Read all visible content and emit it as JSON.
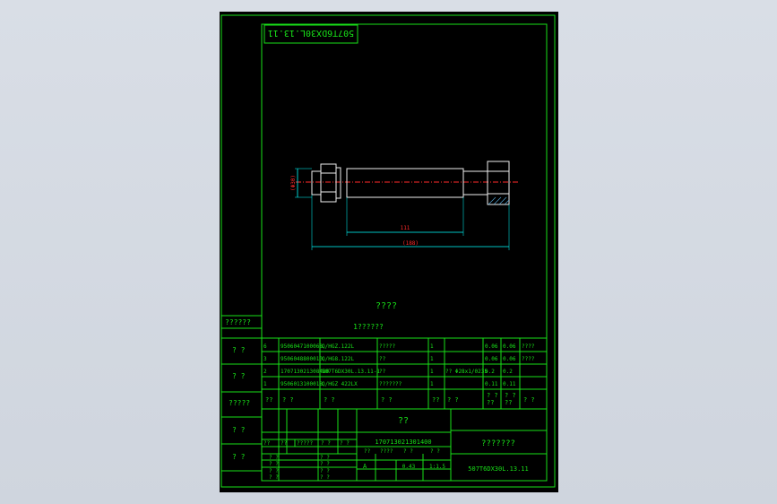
{
  "drawing": {
    "title_block_code_rotated": "507T6DX30L.13.11",
    "dimension_vertical": "(Φ30)",
    "dimension_inner_length": "111",
    "dimension_total_length": "(188)",
    "center_note_1": "????",
    "center_note_2": "1??????"
  },
  "left_strip": {
    "labels": [
      "??????",
      "? ?",
      "? ?",
      "?????",
      "? ?",
      "? ?"
    ]
  },
  "bom": {
    "rows": [
      {
        "no": "6",
        "code": "9506047100068",
        "std": "Q/HGZ.122L",
        "name": "?????",
        "qty": "1",
        "mat": "",
        "w1": "0.06",
        "w2": "0.06",
        "note": "????"
      },
      {
        "no": "3",
        "code": "9506048800010",
        "std": "Q/HG8.122L",
        "name": "??",
        "qty": "1",
        "mat": "",
        "w1": "0.06",
        "w2": "0.06",
        "note": "????"
      },
      {
        "no": "2",
        "code": "170713021308480",
        "std": "507T6DX30L.13.11-1",
        "name": "??",
        "qty": "1",
        "mat": "?? Φ28x1/0235",
        "w1": "0.2",
        "w2": "0.2",
        "note": ""
      },
      {
        "no": "1",
        "code": "9506013100018",
        "std": "Q/HGZ 422LX",
        "name": "???????",
        "qty": "1",
        "mat": "",
        "w1": "0.11",
        "w2": "0.11",
        "note": ""
      }
    ],
    "header": {
      "no": "??",
      "code": "? ?",
      "std": "? ?",
      "name": "? ?",
      "qty": "??",
      "mat": "? ?",
      "w1": "? ?\n??",
      "w2": "? ?\n??",
      "note": "? ?"
    }
  },
  "title_block": {
    "name": "??",
    "drawing_no": "170713021301400",
    "company": "???????",
    "code": "507T6DX30L.13.11",
    "stage": "A",
    "weight": "0.43",
    "scale": "1:1.5",
    "sign_labels": [
      "??",
      "??",
      "?????",
      "? ?",
      "? ?",
      "? ?"
    ],
    "side_labels": [
      "? ?",
      "? ?",
      "? ?",
      "? ?"
    ],
    "mid_labels": [
      "??",
      "? ?",
      "????",
      "? ?",
      "? ?"
    ]
  }
}
